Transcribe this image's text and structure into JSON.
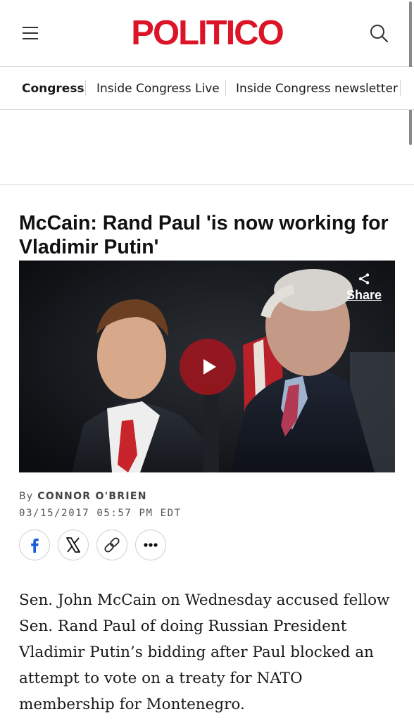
{
  "header": {
    "logo_text": "POLITICO",
    "menu_icon": "hamburger-menu-icon",
    "search_icon": "search-icon",
    "brand_color": "#dc1428"
  },
  "subnav": {
    "items": [
      {
        "label": "Congress",
        "active": true
      },
      {
        "label": "Inside Congress Live",
        "active": false
      },
      {
        "label": "Inside Congress newsletter",
        "active": false
      }
    ]
  },
  "article": {
    "headline": "McCain: Rand Paul 'is now working for Vladimir Putin'",
    "video": {
      "share_label": "Share",
      "share_icon": "share-icon",
      "play_icon": "play-icon",
      "play_color": "#a0141e"
    },
    "byline_prefix": "By",
    "author": "CONNOR O'BRIEN",
    "timestamp": "03/15/2017 05:57 PM EDT",
    "social": [
      "facebook-icon",
      "x-icon",
      "link-icon",
      "more-icon"
    ],
    "body": "Sen. John McCain on Wednesday accused fellow Sen. Rand Paul of doing Russian President Vladimir Putin’s bidding after Paul blocked an attempt to vote on a treaty for NATO membership for Montenegro."
  }
}
